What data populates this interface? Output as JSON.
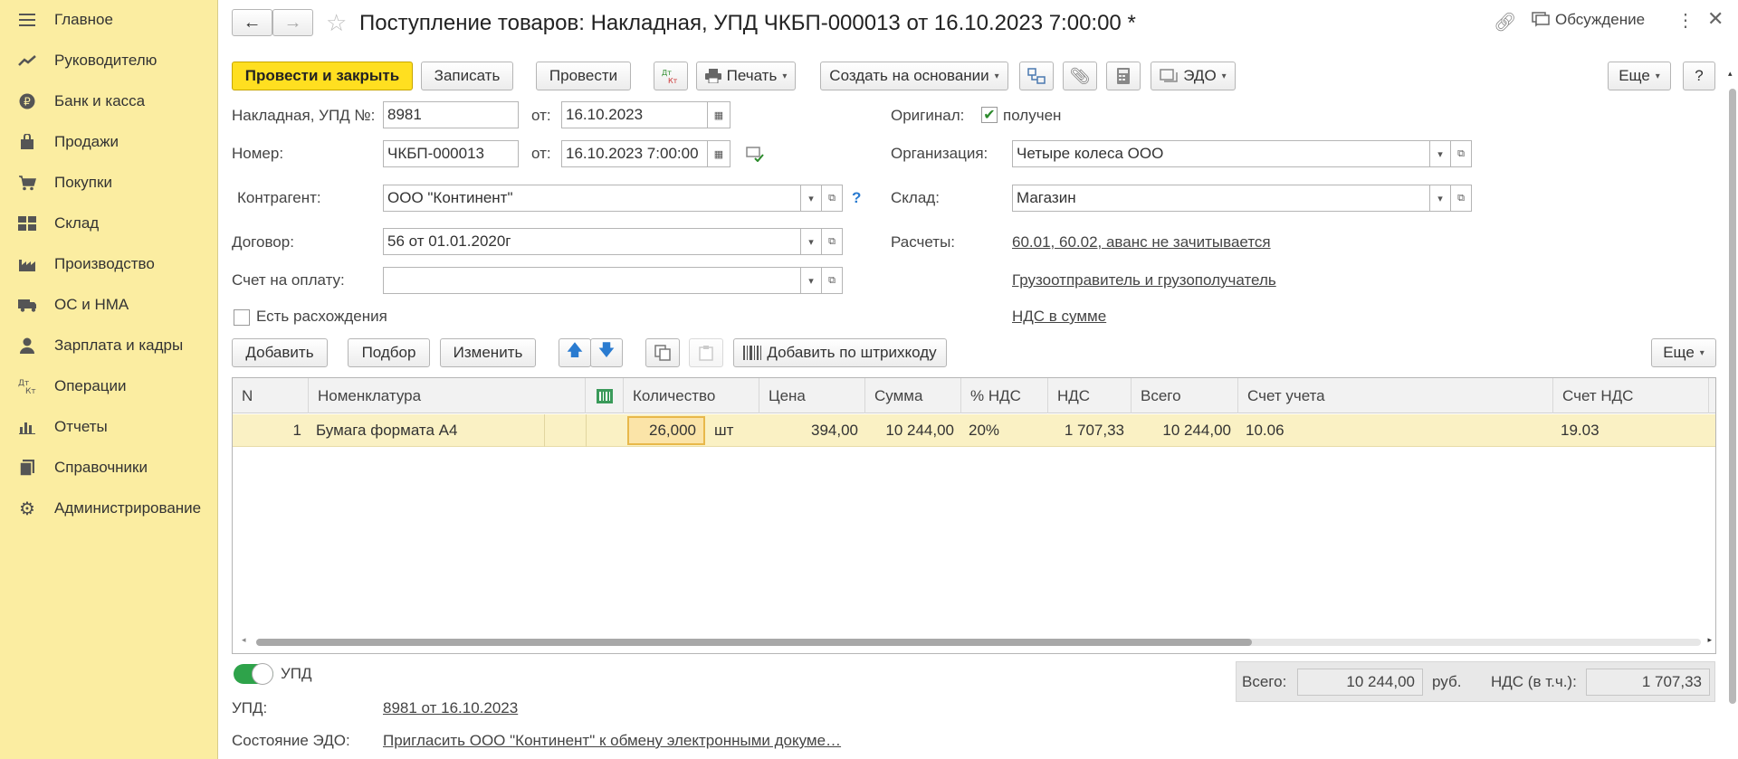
{
  "sidebar": {
    "items": [
      {
        "label": "Главное",
        "icon": "menu-icon"
      },
      {
        "label": "Руководителю",
        "icon": "trend-icon"
      },
      {
        "label": "Банк и касса",
        "icon": "ruble-coin-icon"
      },
      {
        "label": "Продажи",
        "icon": "shopping-bag-icon"
      },
      {
        "label": "Покупки",
        "icon": "cart-icon"
      },
      {
        "label": "Склад",
        "icon": "warehouse-icon"
      },
      {
        "label": "Производство",
        "icon": "factory-icon"
      },
      {
        "label": "ОС и НМА",
        "icon": "truck-icon"
      },
      {
        "label": "Зарплата и кадры",
        "icon": "person-icon"
      },
      {
        "label": "Операции",
        "icon": "dt-kt-icon"
      },
      {
        "label": "Отчеты",
        "icon": "bar-chart-icon"
      },
      {
        "label": "Справочники",
        "icon": "books-icon"
      },
      {
        "label": "Администрирование",
        "icon": "gear-icon"
      }
    ]
  },
  "header": {
    "title": "Поступление товаров: Накладная, УПД ЧКБП-000013 от 16.10.2023 7:00:00 *",
    "discussion_label": "Обсуждение"
  },
  "toolbar": {
    "post_close": "Провести и закрыть",
    "save": "Записать",
    "post": "Провести",
    "dtkt": "Дт Кт",
    "print": "Печать",
    "create_based": "Создать на основании",
    "edo": "ЭДО",
    "more": "Еще",
    "help": "?"
  },
  "form": {
    "invoice_label": "Накладная, УПД №:",
    "invoice_value": "8981",
    "from_label": "от:",
    "invoice_date": "16.10.2023",
    "number_label": "Номер:",
    "number_value": "ЧКБП-000013",
    "number_date": "16.10.2023  7:00:00",
    "contractor_label": "Контрагент:",
    "contractor_value": "ООО \"Континент\"",
    "contract_label": "Договор:",
    "contract_value": "56 от 01.01.2020г",
    "payment_label": "Счет на оплату:",
    "payment_value": "",
    "discrepancy_label": "Есть расхождения",
    "original_label": "Оригинал:",
    "original_value": "получен",
    "org_label": "Организация:",
    "org_value": "Четыре колеса ООО",
    "warehouse_label": "Склад:",
    "warehouse_value": "Магазин",
    "settlements_label": "Расчеты:",
    "settlements_link": "60.01, 60.02, аванс не зачитывается",
    "shipper_link": "Грузоотправитель и грузополучатель",
    "vat_link": "НДС в сумме",
    "help_mark": "?"
  },
  "table_toolbar": {
    "add": "Добавить",
    "pick": "Подбор",
    "edit": "Изменить",
    "barcode": "Добавить по штрихкоду",
    "more": "Еще"
  },
  "table": {
    "headers": [
      "N",
      "Номенклатура",
      "Количество",
      "Цена",
      "Сумма",
      "% НДС",
      "НДС",
      "Всего",
      "Счет учета",
      "Счет НДС"
    ],
    "rows": [
      {
        "n": "1",
        "item": "Бумага формата А4",
        "qty": "26,000",
        "unit": "шт",
        "price": "394,00",
        "sum": "10 244,00",
        "vat_rate": "20%",
        "vat": "1 707,33",
        "total": "10 244,00",
        "account": "10.06",
        "vat_account": "19.03"
      }
    ]
  },
  "footer": {
    "upd_toggle_label": "УПД",
    "upd_label": "УПД:",
    "upd_link": "8981 от 16.10.2023",
    "edo_state_label": "Состояние ЭДО:",
    "edo_state_link": "Пригласить ООО \"Континент\" к обмену электронными докуме…",
    "total_label": "Всего:",
    "total_value": "10 244,00",
    "currency": "руб.",
    "vat_incl_label": "НДС (в т.ч.):",
    "vat_incl_value": "1 707,33"
  },
  "colors": {
    "sidebar_bg": "#fbeda1",
    "primary_button": "#ffdf20",
    "selected_row": "#faf1c4",
    "link": "#2a5ca8",
    "toggle_on": "#2ea34a"
  }
}
